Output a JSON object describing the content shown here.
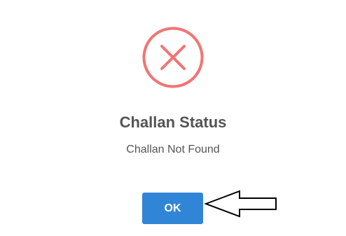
{
  "dialog": {
    "icon": "error-x-icon",
    "icon_color": "#f27474",
    "title": "Challan Status",
    "message": "Challan Not Found",
    "ok_label": "OK",
    "ok_color": "#3085d6"
  },
  "annotation": {
    "icon": "left-arrow-outline-icon"
  }
}
